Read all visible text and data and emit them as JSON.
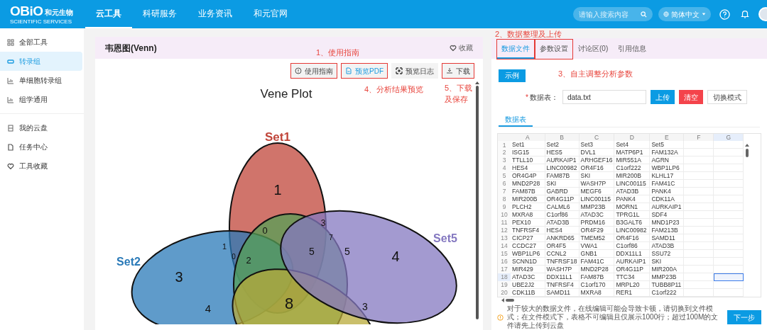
{
  "topbar": {
    "logo": "OBiO",
    "logo_cn": "和元生物",
    "logo_sub": "SCIENTIFIC SERVICES",
    "nav": [
      {
        "label": "云工具",
        "selected": true
      },
      {
        "label": "科研服务",
        "selected": false
      },
      {
        "label": "业务资讯",
        "selected": false
      },
      {
        "label": "和元官网",
        "selected": false
      }
    ],
    "search": {
      "placeholder": "请输入搜索内容"
    },
    "language": "简体中文"
  },
  "sidebar": {
    "groups": [
      [
        {
          "label": "全部工具",
          "selected": false
        },
        {
          "label": "转录组",
          "selected": true
        },
        {
          "label": "单细胞转录组",
          "selected": false
        },
        {
          "label": "组学通用",
          "selected": false
        }
      ],
      [
        {
          "label": "我的云盘",
          "selected": false
        },
        {
          "label": "任务中心",
          "selected": false
        },
        {
          "label": "工具收藏",
          "selected": false
        }
      ]
    ]
  },
  "tool": {
    "title": "韦恩图(Venn)",
    "favorite": "收藏",
    "toolbar": [
      {
        "label": "使用指南",
        "highlighted": true,
        "primary": false
      },
      {
        "label": "预览PDF",
        "highlighted": true,
        "primary": true
      },
      {
        "label": "预览日志",
        "highlighted": false,
        "primary": false
      },
      {
        "label": "下载",
        "highlighted": true,
        "primary": false
      }
    ],
    "venn": {
      "title": "Vene Plot",
      "sets": [
        {
          "name": "Set1",
          "color": "#c0453a"
        },
        {
          "name": "Set2",
          "color": "#2a7ab8"
        },
        {
          "name": "Set5",
          "color": "#8478c0"
        }
      ],
      "regions": [
        "1",
        "0",
        "3",
        "7",
        "1",
        "0",
        "2",
        "5",
        "5",
        "3",
        "4",
        "4",
        "8",
        "3"
      ]
    }
  },
  "panel": {
    "tabs": [
      {
        "label": "数据文件",
        "selected": true,
        "highlighted": true
      },
      {
        "label": "参数设置",
        "selected": false,
        "highlighted": true
      },
      {
        "label": "讨论区(0)",
        "selected": false,
        "highlighted": false
      },
      {
        "label": "引用信息",
        "selected": false,
        "highlighted": false
      }
    ],
    "example_button": "示例",
    "field_required": "*",
    "field_label": "数据表：",
    "field_value": "data.txt",
    "buttons": [
      {
        "label": "上传",
        "kind": "primary"
      },
      {
        "label": "清空",
        "kind": "danger"
      },
      {
        "label": "切换模式",
        "kind": "plain"
      }
    ],
    "subtabs": [
      {
        "label": "数据表",
        "selected": true
      }
    ],
    "sheet": {
      "columns": [
        "A",
        "B",
        "C",
        "D",
        "E",
        "F",
        "G"
      ],
      "rows": [
        {
          "number": "1",
          "cells": [
            "Set1",
            "Set2",
            "Set3",
            "Set4",
            "Set5"
          ],
          "selected": false
        },
        {
          "number": "2",
          "cells": [
            "ISG15",
            "HES5",
            "DVL1",
            "MATP6P1",
            "FAM132A"
          ],
          "selected": false
        },
        {
          "number": "3",
          "cells": [
            "TTLL10",
            "AURKAIP1",
            "ARHGEF16",
            "MIR551A",
            "AGRN"
          ],
          "selected": false
        },
        {
          "number": "4",
          "cells": [
            "HES4",
            "LINC00982",
            "OR4F16",
            "C1orf222",
            "WBP1LP6"
          ],
          "selected": false
        },
        {
          "number": "5",
          "cells": [
            "OR4G4P",
            "FAM87B",
            "SKI",
            "MIR200B",
            "KLHL17"
          ],
          "selected": false
        },
        {
          "number": "6",
          "cells": [
            "MND2P28",
            "SKI",
            "WASH7P",
            "LINC00115",
            "FAM41C"
          ],
          "selected": false
        },
        {
          "number": "7",
          "cells": [
            "FAM87B",
            "GABRD",
            "MEGF6",
            "ATAD3B",
            "PANK4"
          ],
          "selected": false
        },
        {
          "number": "8",
          "cells": [
            "MIR200B",
            "OR4G11P",
            "LINC00115",
            "PANK4",
            "CDK11A"
          ],
          "selected": false
        },
        {
          "number": "9",
          "cells": [
            "PLCH2",
            "CALML6",
            "MMP23B",
            "MORN1",
            "AURKAIP1"
          ],
          "selected": false
        },
        {
          "number": "10",
          "cells": [
            "MXRA8",
            "C1orf86",
            "ATAD3C",
            "TPRG1L",
            "SDF4"
          ],
          "selected": false
        },
        {
          "number": "11",
          "cells": [
            "PEX10",
            "ATAD3B",
            "PRDM16",
            "B3GALT6",
            "MND1P23"
          ],
          "selected": false
        },
        {
          "number": "12",
          "cells": [
            "TNFRSF4",
            "HES4",
            "OR4F29",
            "LINC00982",
            "FAM213B"
          ],
          "selected": false
        },
        {
          "number": "13",
          "cells": [
            "CICP27",
            "ANKRD65",
            "TMEM52",
            "OR4F16",
            "SAMD11"
          ],
          "selected": false
        },
        {
          "number": "14",
          "cells": [
            "CCDC27",
            "OR4F5",
            "VWA1",
            "C1orf86",
            "ATAD3B"
          ],
          "selected": false
        },
        {
          "number": "15",
          "cells": [
            "WBP1LP6",
            "CCNL2",
            "GNB1",
            "DDX11L1",
            "SSU72"
          ],
          "selected": false
        },
        {
          "number": "16",
          "cells": [
            "SCNN1D",
            "TNFRSF18",
            "FAM41C",
            "AURKAIP1",
            "SKI"
          ],
          "selected": false
        },
        {
          "number": "17",
          "cells": [
            "MIR429",
            "WASH7P",
            "MND2P28",
            "OR4G11P",
            "MIR200A"
          ],
          "selected": false
        },
        {
          "number": "18",
          "cells": [
            "ATAD3C",
            "DDX11L1",
            "FAM87B",
            "TTC34",
            "MMP23B"
          ],
          "selected": true
        },
        {
          "number": "19",
          "cells": [
            "UBE2J2",
            "TNFRSF4",
            "C1orf170",
            "MRPL20",
            "TUBB8P11"
          ],
          "selected": false
        },
        {
          "number": "20",
          "cells": [
            "CDK11B",
            "SAMD11",
            "MXRA8",
            "RER1",
            "C1orf222"
          ],
          "selected": false
        }
      ]
    },
    "notice": "对于较大的数据文件，在线编辑可能会导致卡顿，请切换到文件模式；在文件模式下，表格不可编辑且仅展示1000行；超过100M的文件请先上传到云盘",
    "next_button": "下一步"
  },
  "annotations": [
    "1、使用指南",
    "2、数据整理及上传",
    "3、自主调整分析参数",
    "4、分析结果预览",
    "5、下载及保存"
  ]
}
